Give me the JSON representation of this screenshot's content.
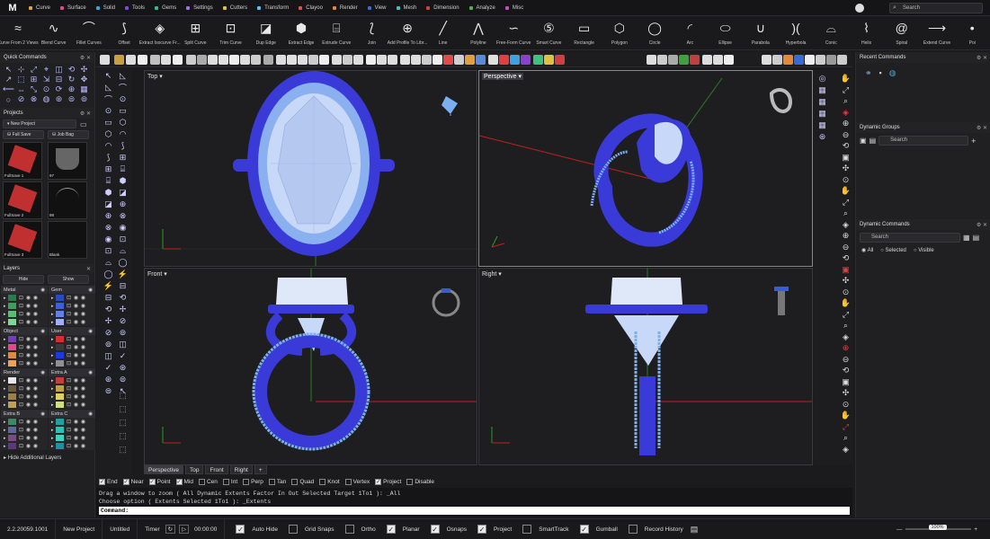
{
  "app": {
    "logo": "M"
  },
  "menu_tabs": [
    {
      "label": "Curve",
      "color": "#e6a23c"
    },
    {
      "label": "Surface",
      "color": "#e04a8a"
    },
    {
      "label": "Solid",
      "color": "#3aa0e0"
    },
    {
      "label": "Tools",
      "color": "#7a4ad8"
    },
    {
      "label": "Gems",
      "color": "#2bbf8a"
    },
    {
      "label": "Settings",
      "color": "#a070e0"
    },
    {
      "label": "Cutters",
      "color": "#e0c040"
    },
    {
      "label": "Transform",
      "color": "#5ac0f0"
    },
    {
      "label": "Clayoo",
      "color": "#e05050"
    },
    {
      "label": "Render",
      "color": "#e08a3a"
    },
    {
      "label": "View",
      "color": "#3a6ad8"
    },
    {
      "label": "Mesh",
      "color": "#40c0c0"
    },
    {
      "label": "Dimension",
      "color": "#d04040"
    },
    {
      "label": "Analyze",
      "color": "#50b050"
    },
    {
      "label": "Misc",
      "color": "#c050c0"
    }
  ],
  "search_placeholder": "Search",
  "toolbar": [
    {
      "label": "Curve From 2 Views",
      "icon": "≈"
    },
    {
      "label": "Blend Curve",
      "icon": "∿"
    },
    {
      "label": "Fillet Curves",
      "icon": "⌒"
    },
    {
      "label": "Offset",
      "icon": "⟆"
    },
    {
      "label": "Extract Isocurve Fr...",
      "icon": "◈"
    },
    {
      "label": "Split Curve",
      "icon": "⊞"
    },
    {
      "label": "Trim Curve",
      "icon": "⊡"
    },
    {
      "label": "Dup Edge",
      "icon": "◪"
    },
    {
      "label": "Extract Edge",
      "icon": "⬢"
    },
    {
      "label": "Extrude Curve",
      "icon": "⌸"
    },
    {
      "label": "Join",
      "icon": "⟅"
    },
    {
      "label": "Add Profile To Libr...",
      "icon": "⊕"
    },
    {
      "label": "Line",
      "icon": "╱"
    },
    {
      "label": "Polyline",
      "icon": "⋀"
    },
    {
      "label": "Free-Form Curve",
      "icon": "∽"
    },
    {
      "label": "Smart Curve",
      "icon": "⑤"
    },
    {
      "label": "Rectangle",
      "icon": "▭"
    },
    {
      "label": "Polygon",
      "icon": "⬡"
    },
    {
      "label": "Circle",
      "icon": "◯"
    },
    {
      "label": "Arc",
      "icon": "◜"
    },
    {
      "label": "Ellipse",
      "icon": "⬭"
    },
    {
      "label": "Parabola",
      "icon": "∪"
    },
    {
      "label": "Hyperbola",
      "icon": ")("
    },
    {
      "label": "Conic",
      "icon": "⌓"
    },
    {
      "label": "Helix",
      "icon": "⌇"
    },
    {
      "label": "Spiral",
      "icon": "@"
    },
    {
      "label": "Extend Curve",
      "icon": "⟶"
    },
    {
      "label": "Poi",
      "icon": "•"
    }
  ],
  "quick_commands": {
    "title": "Quick Commands"
  },
  "projects": {
    "title": "Projects",
    "new_project": "New Project",
    "full_save": "Full Save",
    "job_bag": "Job Bag",
    "thumbs": [
      {
        "caption": "FullSave 1"
      },
      {
        "caption": "97"
      },
      {
        "caption": "FullSave 2"
      },
      {
        "caption": "98"
      },
      {
        "caption": "FullSave 3"
      },
      {
        "caption": "Blank"
      }
    ]
  },
  "layers": {
    "title": "Layers",
    "hide": "Hide",
    "show": "Show",
    "groups": [
      {
        "name": "Metal",
        "swatches": [
          "#2a7a4a",
          "#3aa05a",
          "#55c070",
          "#80d890"
        ]
      },
      {
        "name": "Gem",
        "swatches": [
          "#2a4ac0",
          "#3a60e0",
          "#6080f0",
          "#a0b0f8"
        ]
      },
      {
        "name": "Object",
        "swatches": [
          "#7a3ac0",
          "#e04a8a",
          "#e08a3a",
          "#f0a050"
        ]
      },
      {
        "name": "User",
        "swatches": [
          "#d03030",
          "#3a3a3a",
          "#1a3ae0",
          "#909090"
        ]
      },
      {
        "name": "Render",
        "swatches": [
          "#e8e8e8",
          "#6a5a3a",
          "#a08040",
          "#c0a050"
        ]
      },
      {
        "name": "Extra A",
        "swatches": [
          "#c04040",
          "#c0a040",
          "#e0d060",
          "#d0e080"
        ]
      },
      {
        "name": "Extra B",
        "swatches": [
          "#3a8a6a",
          "#5a6a9a",
          "#7a4a8a",
          "#5a3a7a"
        ]
      },
      {
        "name": "Extra C",
        "swatches": [
          "#20a0a0",
          "#30c0b0",
          "#40d0c0",
          "#2090a0"
        ]
      }
    ],
    "hide_additional": "Hide Additional Layers"
  },
  "viewports": {
    "top": "Top",
    "perspective": "Perspective",
    "front": "Front",
    "right": "Right"
  },
  "vp_tabs": [
    "Perspective",
    "Top",
    "Front",
    "Right"
  ],
  "osnaps": [
    {
      "label": "End",
      "on": true
    },
    {
      "label": "Near",
      "on": true
    },
    {
      "label": "Point",
      "on": true
    },
    {
      "label": "Mid",
      "on": true
    },
    {
      "label": "Cen",
      "on": false
    },
    {
      "label": "Int",
      "on": false
    },
    {
      "label": "Perp",
      "on": false
    },
    {
      "label": "Tan",
      "on": false
    },
    {
      "label": "Quad",
      "on": false
    },
    {
      "label": "Knot",
      "on": false
    },
    {
      "label": "Vertex",
      "on": false
    },
    {
      "label": "Project",
      "on": true
    },
    {
      "label": "Disable",
      "on": false
    }
  ],
  "command": {
    "line1": "Drag a window to zoom ( All  Dynamic  Extents  Factor  In  Out  Selected  Target  1To1 ): _All",
    "line2": "Choose option ( Extents  Selected  1To1 ): _Extents",
    "prompt": "Command:"
  },
  "right_panels": {
    "recent": "Recent Commands",
    "dyn_groups": "Dynamic Groups",
    "dyn_groups_search": "Search",
    "dyn_commands": "Dynamic Commands",
    "dyn_commands_search": "Search",
    "opt_all": "All",
    "opt_selected": "Selected",
    "opt_visible": "Visible"
  },
  "status": {
    "version": "2.2.20059.1001",
    "new_project": "New Project",
    "untitled": "Untitled",
    "timer": "Timer",
    "timer_value": "00:00:00",
    "items": [
      {
        "label": "Auto Hide",
        "on": true
      },
      {
        "label": "Grid Snaps",
        "on": false
      },
      {
        "label": "Ortho",
        "on": false
      },
      {
        "label": "Planar",
        "on": true
      },
      {
        "label": "Osnaps",
        "on": true
      },
      {
        "label": "Project",
        "on": true
      },
      {
        "label": "SmartTrack",
        "on": false
      },
      {
        "label": "Gumball",
        "on": true
      },
      {
        "label": "Record History",
        "on": false
      }
    ],
    "zoom": "100%"
  },
  "colors": {
    "ring_blue": "#3a3ad8",
    "gem_light": "#c8d8f8",
    "bead": "#7ab0f0"
  }
}
